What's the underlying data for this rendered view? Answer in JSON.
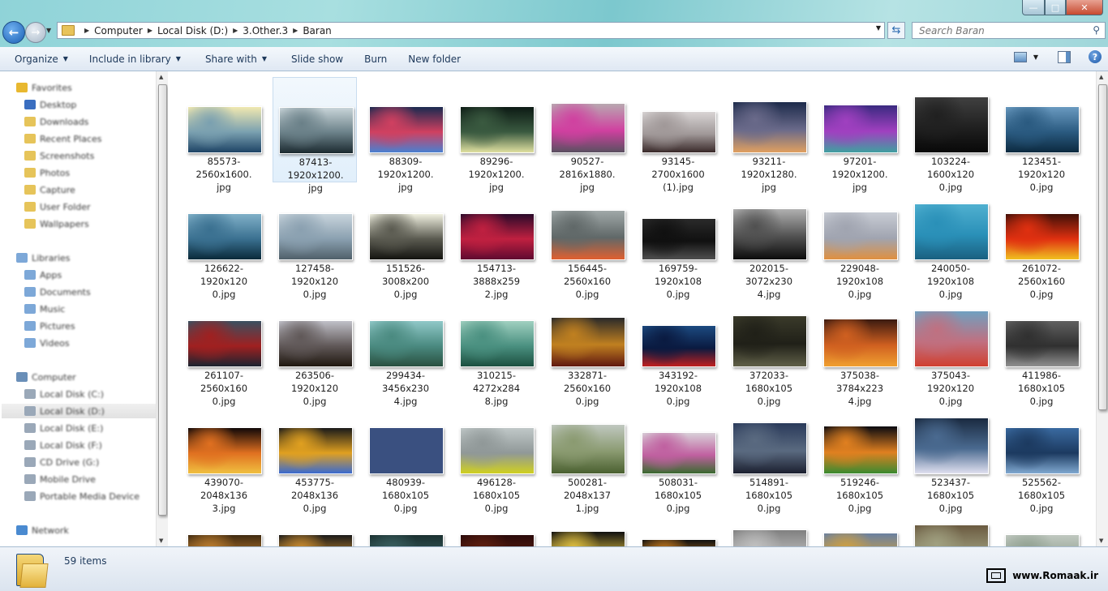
{
  "window": {
    "minimize_glyph": "—",
    "maximize_glyph": "□",
    "close_glyph": "✕"
  },
  "address": {
    "crumbs": [
      "Computer",
      "Local Disk (D:)",
      "3.Other.3",
      "Baran"
    ]
  },
  "search": {
    "placeholder": "Search Baran"
  },
  "toolbar": {
    "organize": "Organize",
    "include_in_library": "Include in library",
    "share_with": "Share with",
    "slide_show": "Slide show",
    "burn": "Burn",
    "new_folder": "New folder"
  },
  "navigation": {
    "items": [
      {
        "label": "Favorites",
        "icon": "star-icon",
        "selected": false
      },
      {
        "label": "Desktop",
        "icon": "desktop-icon",
        "selected": false
      },
      {
        "label": "Downloads",
        "icon": "folder-icon",
        "selected": false
      },
      {
        "label": "Recent Places",
        "icon": "folder-icon",
        "selected": false
      },
      {
        "label": "Screenshots",
        "icon": "folder-icon",
        "selected": false
      },
      {
        "label": "Photos",
        "icon": "folder-icon",
        "selected": false
      },
      {
        "label": "Capture",
        "icon": "folder-icon",
        "selected": false
      },
      {
        "label": "User Folder",
        "icon": "folder-icon",
        "selected": false
      },
      {
        "label": "Wallpapers",
        "icon": "folder-icon",
        "selected": false
      },
      {
        "label": "Libraries",
        "icon": "library-icon",
        "selected": false
      },
      {
        "label": "Apps",
        "icon": "library-icon",
        "selected": false
      },
      {
        "label": "Documents",
        "icon": "library-icon",
        "selected": false
      },
      {
        "label": "Music",
        "icon": "library-icon",
        "selected": false
      },
      {
        "label": "Pictures",
        "icon": "library-icon",
        "selected": false
      },
      {
        "label": "Videos",
        "icon": "library-icon",
        "selected": false
      },
      {
        "label": "Computer",
        "icon": "computer-icon",
        "selected": false
      },
      {
        "label": "Local Disk (C:)",
        "icon": "drive-icon",
        "selected": false
      },
      {
        "label": "Local Disk (D:)",
        "icon": "drive-icon",
        "selected": true
      },
      {
        "label": "Local Disk (E:)",
        "icon": "drive-icon",
        "selected": false
      },
      {
        "label": "Local Disk (F:)",
        "icon": "drive-icon",
        "selected": false
      },
      {
        "label": "CD Drive (G:)",
        "icon": "drive-icon",
        "selected": false
      },
      {
        "label": "Mobile Drive",
        "icon": "drive-icon",
        "selected": false
      },
      {
        "label": "Portable Media Device",
        "icon": "drive-icon",
        "selected": false
      },
      {
        "label": "Network",
        "icon": "network-icon",
        "selected": false
      }
    ]
  },
  "files": [
    {
      "line1": "85573-2560x1600.",
      "line2": "jpg",
      "colors": [
        "#f0e8b0",
        "#7aa0b0",
        "#1e4466"
      ]
    },
    {
      "line1": "87413-1920x1200.",
      "line2": "jpg",
      "colors": [
        "#c8d4d8",
        "#6a8088",
        "#1c2a30"
      ]
    },
    {
      "line1": "88309-1920x1200.",
      "line2": "jpg",
      "colors": [
        "#1a2a50",
        "#d04060",
        "#4a80d0"
      ]
    },
    {
      "line1": "89296-1920x1200.",
      "line2": "jpg",
      "colors": [
        "#0c1a14",
        "#3a5a40",
        "#e0e0a0"
      ]
    },
    {
      "line1": "90527-2816x1880.",
      "line2": "jpg",
      "colors": [
        "#b8a8b0",
        "#d040a0",
        "#5a5060"
      ]
    },
    {
      "line1": "93145-2700x1600",
      "line2": "(1).jpg",
      "colors": [
        "#d8d4d4",
        "#a09898",
        "#3a2a2a"
      ]
    },
    {
      "line1": "93211-1920x1280.",
      "line2": "jpg",
      "colors": [
        "#1c2a4a",
        "#6a6a8a",
        "#e0a060"
      ]
    },
    {
      "line1": "97201-1920x1200.",
      "line2": "jpg",
      "colors": [
        "#3a2a80",
        "#a040c0",
        "#40a0a0"
      ]
    },
    {
      "line1": "103224-1600x120",
      "line2": "0.jpg",
      "colors": [
        "#404040",
        "#202020",
        "#080808"
      ]
    },
    {
      "line1": "123451-1920x120",
      "line2": "0.jpg",
      "colors": [
        "#6a9ac0",
        "#2a5a80",
        "#0c2a40"
      ]
    },
    {
      "line1": "126622-1920x120",
      "line2": "0.jpg",
      "colors": [
        "#80b0c8",
        "#3a7090",
        "#0a2a3a"
      ]
    },
    {
      "line1": "127458-1920x120",
      "line2": "0.jpg",
      "colors": [
        "#c8d4dc",
        "#8aa0b0",
        "#50606a"
      ]
    },
    {
      "line1": "151526-3008x200",
      "line2": "0.jpg",
      "colors": [
        "#f0f0e0",
        "#5a5a50",
        "#141410"
      ]
    },
    {
      "line1": "154713-3888x259",
      "line2": "2.jpg",
      "colors": [
        "#2a0a2a",
        "#c02040",
        "#600a30"
      ]
    },
    {
      "line1": "156445-2560x160",
      "line2": "0.jpg",
      "colors": [
        "#a0a8a8",
        "#606868",
        "#e06030"
      ]
    },
    {
      "line1": "169759-1920x108",
      "line2": "0.jpg",
      "colors": [
        "#2a2a2a",
        "#101010",
        "#505050"
      ]
    },
    {
      "line1": "202015-3072x230",
      "line2": "4.jpg",
      "colors": [
        "#b0b0b0",
        "#505050",
        "#0c0c0c"
      ]
    },
    {
      "line1": "229048-1920x108",
      "line2": "0.jpg",
      "colors": [
        "#c8ccd4",
        "#a0a4b0",
        "#e09040"
      ]
    },
    {
      "line1": "240050-1920x108",
      "line2": "0.jpg",
      "colors": [
        "#50b0d0",
        "#2a90b8",
        "#1a6080"
      ]
    },
    {
      "line1": "261072-2560x160",
      "line2": "0.jpg",
      "colors": [
        "#401008",
        "#e03010",
        "#f0c020"
      ]
    },
    {
      "line1": "261107-2560x160",
      "line2": "0.jpg",
      "colors": [
        "#3a5060",
        "#a02020",
        "#1c2430"
      ]
    },
    {
      "line1": "263506-1920x120",
      "line2": "0.jpg",
      "colors": [
        "#c0c0c8",
        "#605858",
        "#201810"
      ]
    },
    {
      "line1": "299434-3456x230",
      "line2": "4.jpg",
      "colors": [
        "#90c8c8",
        "#4a8a80",
        "#2a5040"
      ]
    },
    {
      "line1": "310215-4272x284",
      "line2": "8.jpg",
      "colors": [
        "#a0d0c0",
        "#4a9080",
        "#1c5040"
      ]
    },
    {
      "line1": "332871-2560x160",
      "line2": "0.jpg",
      "colors": [
        "#2a2a2a",
        "#c08020",
        "#601810"
      ]
    },
    {
      "line1": "343192-1920x108",
      "line2": "0.jpg",
      "colors": [
        "#1c4a80",
        "#0a1a40",
        "#c02020"
      ]
    },
    {
      "line1": "372033-1680x105",
      "line2": "0.jpg",
      "colors": [
        "#3a3a2a",
        "#202018",
        "#606048"
      ]
    },
    {
      "line1": "375038-3784x223",
      "line2": "4.jpg",
      "colors": [
        "#3a1a10",
        "#d06020",
        "#f0a030"
      ]
    },
    {
      "line1": "375043-1920x120",
      "line2": "0.jpg",
      "colors": [
        "#70a0c0",
        "#c07080",
        "#d04030"
      ]
    },
    {
      "line1": "411986-1680x105",
      "line2": "0.jpg",
      "colors": [
        "#606060",
        "#303030",
        "#909090"
      ]
    },
    {
      "line1": "439070-2048x136",
      "line2": "3.jpg",
      "colors": [
        "#100808",
        "#e07020",
        "#f0c040"
      ]
    },
    {
      "line1": "453775-2048x136",
      "line2": "0.jpg",
      "colors": [
        "#1a1a1a",
        "#e0a020",
        "#3a6ad0"
      ]
    },
    {
      "line1": "480939-1680x105",
      "line2": "0.jpg",
      "colors": [
        "#3a5080",
        "#3a5080",
        "#3a5080"
      ]
    },
    {
      "line1": "496128-1680x105",
      "line2": "0.jpg",
      "colors": [
        "#c0c8c8",
        "#909898",
        "#d0d020"
      ]
    },
    {
      "line1": "500281-2048x137",
      "line2": "1.jpg",
      "colors": [
        "#c0c8c0",
        "#8a9a70",
        "#4a6030"
      ]
    },
    {
      "line1": "508031-1680x105",
      "line2": "0.jpg",
      "colors": [
        "#d8d0d8",
        "#c060a0",
        "#3a6a30"
      ]
    },
    {
      "line1": "514891-1680x105",
      "line2": "0.jpg",
      "colors": [
        "#2a3a5a",
        "#5a6a80",
        "#1c2030"
      ]
    },
    {
      "line1": "519246-1680x105",
      "line2": "0.jpg",
      "colors": [
        "#0a0a10",
        "#e08020",
        "#3a8a30"
      ]
    },
    {
      "line1": "523437-1680x105",
      "line2": "0.jpg",
      "colors": [
        "#1a2a40",
        "#4a6a90",
        "#e0e0f0"
      ]
    },
    {
      "line1": "525562-1680x105",
      "line2": "0.jpg",
      "colors": [
        "#3a6aa0",
        "#1c3a60",
        "#80a8d0"
      ]
    },
    {
      "line1": "",
      "line2": "",
      "colors": [
        "#402a10",
        "#c08030",
        "#201008"
      ]
    },
    {
      "line1": "",
      "line2": "",
      "colors": [
        "#1a1a1a",
        "#d09030",
        "#402010"
      ]
    },
    {
      "line1": "",
      "line2": "",
      "colors": [
        "#1a3030",
        "#3a6060",
        "#0a1a1a"
      ]
    },
    {
      "line1": "",
      "line2": "",
      "colors": [
        "#2a0a0a",
        "#602010",
        "#100404"
      ]
    },
    {
      "line1": "",
      "line2": "",
      "colors": [
        "#101010",
        "#e0c040",
        "#303030"
      ]
    },
    {
      "line1": "",
      "line2": "",
      "colors": [
        "#101010",
        "#d08020",
        "#404040"
      ]
    },
    {
      "line1": "",
      "line2": "",
      "colors": [
        "#808080",
        "#c0c0c0",
        "#404040"
      ]
    },
    {
      "line1": "",
      "line2": "",
      "colors": [
        "#6a80a0",
        "#d0a040",
        "#304050"
      ]
    },
    {
      "line1": "",
      "line2": "",
      "colors": [
        "#6a5a40",
        "#a0a080",
        "#302a20"
      ]
    },
    {
      "line1": "",
      "line2": "",
      "colors": [
        "#c0c8c0",
        "#90a090",
        "#606a60"
      ]
    }
  ],
  "status": {
    "item_count": "59 items"
  },
  "watermark": {
    "text": "www.Romaak.ir"
  }
}
